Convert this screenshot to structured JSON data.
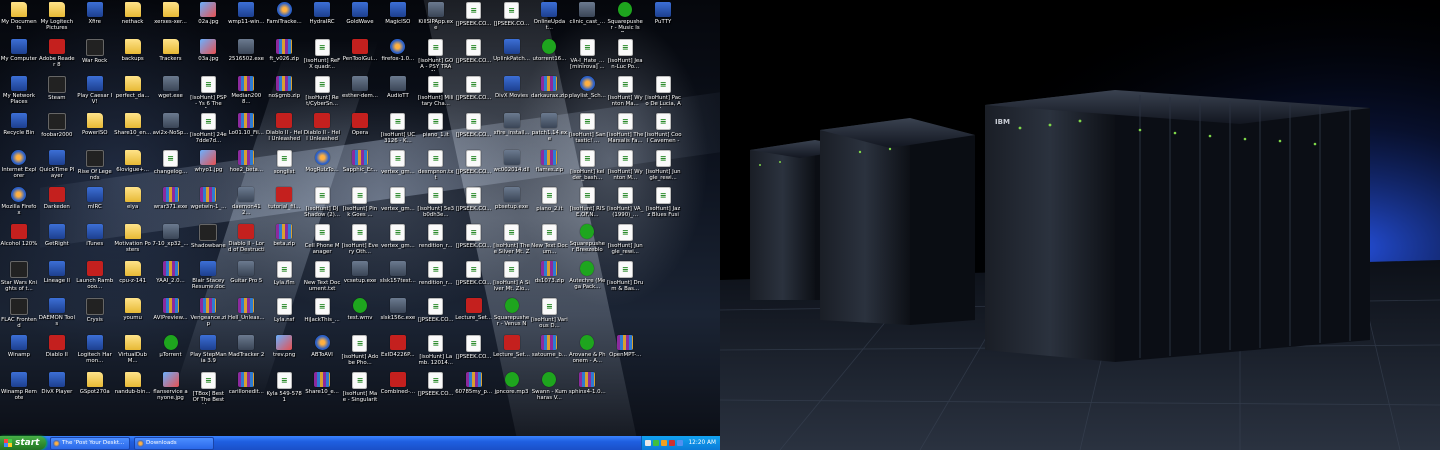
{
  "colors": {
    "taskbar": "#245edc",
    "start": "#2e8b2e",
    "tray": "#0f8fe8",
    "wallpaper_glow": "#2a5cff"
  },
  "desktop_icons": [
    {
      "label": "My Documents",
      "icon": "folder"
    },
    {
      "label": "My Logitech Pictures",
      "icon": "folder"
    },
    {
      "label": "Xfire",
      "icon": "app"
    },
    {
      "label": "nethack",
      "icon": "folder"
    },
    {
      "label": "xerxes-xer...",
      "icon": "folder"
    },
    {
      "label": "02a.jpg",
      "icon": "image"
    },
    {
      "label": "wmp11-win...",
      "icon": "app"
    },
    {
      "label": "FamiTracke...",
      "icon": "web"
    },
    {
      "label": "HydraIRC",
      "icon": "app"
    },
    {
      "label": "GoldWave",
      "icon": "app"
    },
    {
      "label": "MagicISO",
      "icon": "app"
    },
    {
      "label": "KillSIPApp.exe",
      "icon": "exe"
    },
    {
      "label": "[JPSEEK.CO...",
      "icon": "doc"
    },
    {
      "label": "[JPSEEK.CO...",
      "icon": "doc"
    },
    {
      "label": "OnlineUpdat...",
      "icon": "app"
    },
    {
      "label": "clinic_cast_...",
      "icon": "exe"
    },
    {
      "label": "Squarepusher - Music Is R...",
      "icon": "media"
    },
    {
      "label": "PuTTY",
      "icon": "app"
    },
    {
      "label": "",
      "icon": "none"
    },
    {
      "label": "My Computer",
      "icon": "app"
    },
    {
      "label": "Adobe Reader 8",
      "icon": "red"
    },
    {
      "label": "War Rock",
      "icon": "dark"
    },
    {
      "label": "backups",
      "icon": "folder"
    },
    {
      "label": "Trackers",
      "icon": "folder"
    },
    {
      "label": "03a.jpg",
      "icon": "image"
    },
    {
      "label": "2516502.exe",
      "icon": "exe"
    },
    {
      "label": "ft_v026.zip",
      "icon": "archive"
    },
    {
      "label": "[isoHunt] ReFX quadr...",
      "icon": "doc"
    },
    {
      "label": "PenToolGui...",
      "icon": "red"
    },
    {
      "label": "firefox-1.0...",
      "icon": "web"
    },
    {
      "label": "[isoHunt] GOA - PSY TRAN...",
      "icon": "doc"
    },
    {
      "label": "[JPSEEK.CO...",
      "icon": "doc"
    },
    {
      "label": "UplinkPatch...",
      "icon": "app"
    },
    {
      "label": "utorrent16...",
      "icon": "media"
    },
    {
      "label": "VA-I_Hate_... [minirova] ...",
      "icon": "doc"
    },
    {
      "label": "[isoHunt] Jean-Luc Po...",
      "icon": "doc"
    },
    {
      "label": "",
      "icon": "none"
    },
    {
      "label": "",
      "icon": "none"
    },
    {
      "label": "My Network Places",
      "icon": "app"
    },
    {
      "label": "Steam",
      "icon": "dark"
    },
    {
      "label": "Play Caesar IV!",
      "icon": "app"
    },
    {
      "label": "perfect_da...",
      "icon": "folder"
    },
    {
      "label": "wget.exe",
      "icon": "exe"
    },
    {
      "label": "[isoHunt] PSP - Ys 6 The A...",
      "icon": "doc"
    },
    {
      "label": "Median2008...",
      "icon": "archive"
    },
    {
      "label": "no$gmb.zip",
      "icon": "archive"
    },
    {
      "label": "[isoHunt] Ret/CyberSn...",
      "icon": "doc"
    },
    {
      "label": "esther-dem...",
      "icon": "exe"
    },
    {
      "label": "AudioTT",
      "icon": "exe"
    },
    {
      "label": "[isoHunt] Military Cha...",
      "icon": "doc"
    },
    {
      "label": "[JPSEEK.CO...",
      "icon": "doc"
    },
    {
      "label": "DivX Movies",
      "icon": "app"
    },
    {
      "label": "darkaurax.zip",
      "icon": "archive"
    },
    {
      "label": "playlist_Sch...",
      "icon": "web"
    },
    {
      "label": "[isoHunt] Wynton Ma...",
      "icon": "doc"
    },
    {
      "label": "[isoHunt] Paco De Lucia, Al...",
      "icon": "doc"
    },
    {
      "label": "",
      "icon": "none"
    },
    {
      "label": "Recycle Bin",
      "icon": "app"
    },
    {
      "label": "foobar2000",
      "icon": "dark"
    },
    {
      "label": "PowerISO",
      "icon": "folder"
    },
    {
      "label": "Share10_en...",
      "icon": "folder"
    },
    {
      "label": "avi2x-NoSp...",
      "icon": "exe"
    },
    {
      "label": "[isoHunt] 24e7dde7d...",
      "icon": "doc"
    },
    {
      "label": "Lo01.10_Fil...",
      "icon": "archive"
    },
    {
      "label": "Diablo II - Hell Unleashed",
      "icon": "red"
    },
    {
      "label": "Diablo II - Hell Unleashed ...",
      "icon": "red"
    },
    {
      "label": "Opera",
      "icon": "red"
    },
    {
      "label": "[isoHunt] UC3126 - K...",
      "icon": "doc"
    },
    {
      "label": "piano_1.it",
      "icon": "doc"
    },
    {
      "label": "[JPSEEK.CO...",
      "icon": "doc"
    },
    {
      "label": "xfire_install...",
      "icon": "exe"
    },
    {
      "label": "patch1.14.exe",
      "icon": "exe"
    },
    {
      "label": "[isoHunt] Santastic! ...",
      "icon": "doc"
    },
    {
      "label": "[isoHunt] The Marsalis Fa...",
      "icon": "doc"
    },
    {
      "label": "[isoHunt] Cool Cavemen - ...",
      "icon": "doc"
    },
    {
      "label": "",
      "icon": "none"
    },
    {
      "label": "Internet Explorer",
      "icon": "web"
    },
    {
      "label": "QuickTime Player",
      "icon": "app"
    },
    {
      "label": "Rise Of Legends",
      "icon": "dark"
    },
    {
      "label": "6lovigue+...",
      "icon": "folder"
    },
    {
      "label": "changelog...",
      "icon": "doc"
    },
    {
      "label": "whyo1.jpg",
      "icon": "image"
    },
    {
      "label": "hoe2_beta...",
      "icon": "archive"
    },
    {
      "label": "songlist",
      "icon": "doc"
    },
    {
      "label": "MogRulzTo...",
      "icon": "web"
    },
    {
      "label": "Sapphic_Er...",
      "icon": "archive"
    },
    {
      "label": "vertex_gm...",
      "icon": "doc"
    },
    {
      "label": "desmpnon.txt",
      "icon": "doc"
    },
    {
      "label": "[JPSEEK.CO...",
      "icon": "doc"
    },
    {
      "label": "wc002014.dll",
      "icon": "exe"
    },
    {
      "label": "flames.zip",
      "icon": "archive"
    },
    {
      "label": "[isoHunt] kelder_bash...",
      "icon": "doc"
    },
    {
      "label": "[isoHunt] Wynton M...",
      "icon": "doc"
    },
    {
      "label": "[isoHunt] Jungle_rewi...",
      "icon": "doc"
    },
    {
      "label": "",
      "icon": "none"
    },
    {
      "label": "Mozilla Firefox",
      "icon": "web"
    },
    {
      "label": "Darkeden",
      "icon": "red"
    },
    {
      "label": "mIRC",
      "icon": "app"
    },
    {
      "label": "eiya",
      "icon": "folder"
    },
    {
      "label": "wrar371.exe",
      "icon": "archive"
    },
    {
      "label": "wgetwin-1_...",
      "icon": "archive"
    },
    {
      "label": "daemon412...",
      "icon": "exe"
    },
    {
      "label": "tutorial_fil...",
      "icon": "red"
    },
    {
      "label": "[isoHunt] DJ Shadow (2)...",
      "icon": "doc"
    },
    {
      "label": "[isoHunt] Pink Goes ...",
      "icon": "doc"
    },
    {
      "label": "vertex_gm...",
      "icon": "doc"
    },
    {
      "label": "[isoHunt] 5e3b0dh3e...",
      "icon": "doc"
    },
    {
      "label": "[JPSEEK.CO...",
      "icon": "doc"
    },
    {
      "label": "pbsetup.exe",
      "icon": "exe"
    },
    {
      "label": "piano_2.it",
      "icon": "doc"
    },
    {
      "label": "[isoHunt] RISE.OF.N...",
      "icon": "doc"
    },
    {
      "label": "[isoHunt] VA_(1990)_...",
      "icon": "doc"
    },
    {
      "label": "[isoHunt] Jazz Blues Fusio...",
      "icon": "doc"
    },
    {
      "label": "",
      "icon": "none"
    },
    {
      "label": "Alcohol 120%",
      "icon": "red"
    },
    {
      "label": "GetRight",
      "icon": "app"
    },
    {
      "label": "iTunes",
      "icon": "app"
    },
    {
      "label": "Motivation Posters",
      "icon": "folder"
    },
    {
      "label": "7-10_xp32_...",
      "icon": "exe"
    },
    {
      "label": "Shadowbane",
      "icon": "dark"
    },
    {
      "label": "Diablo II - Lord of Destruction",
      "icon": "red"
    },
    {
      "label": "beta.zip",
      "icon": "archive"
    },
    {
      "label": "Cell Phone Manager",
      "icon": "doc"
    },
    {
      "label": "[isoHunt] Every Oth...",
      "icon": "doc"
    },
    {
      "label": "vertex_gm...",
      "icon": "doc"
    },
    {
      "label": "rendition_r...",
      "icon": "doc"
    },
    {
      "label": "[JPSEEK.CO...",
      "icon": "doc"
    },
    {
      "label": "[isoHunt] Thee Silver Mt. Zi...",
      "icon": "doc"
    },
    {
      "label": "New Text Docum...",
      "icon": "doc"
    },
    {
      "label": "Squarepusher Breezeblo c...",
      "icon": "media"
    },
    {
      "label": "[isoHunt] Jungle_rewi...",
      "icon": "doc"
    },
    {
      "label": "",
      "icon": "none"
    },
    {
      "label": "",
      "icon": "none"
    },
    {
      "label": "Star Wars Knights of t...",
      "icon": "dark"
    },
    {
      "label": "Lineage II",
      "icon": "app"
    },
    {
      "label": "Launch Rambooo...",
      "icon": "red"
    },
    {
      "label": "cpu-z-141",
      "icon": "folder"
    },
    {
      "label": "YAAI_2.0...",
      "icon": "archive"
    },
    {
      "label": "Blair Stacey Resume.doc",
      "icon": "app"
    },
    {
      "label": "Guitar Pro 5",
      "icon": "exe"
    },
    {
      "label": "Lyla.flm",
      "icon": "doc"
    },
    {
      "label": "New Text Document.txt",
      "icon": "doc"
    },
    {
      "label": "vcsetup.exe",
      "icon": "exe"
    },
    {
      "label": "slsk157test...",
      "icon": "exe"
    },
    {
      "label": "rendition_r...",
      "icon": "doc"
    },
    {
      "label": "[JPSEEK.CO...",
      "icon": "doc"
    },
    {
      "label": "[isoHunt] A Silver Mt. Zio...",
      "icon": "doc"
    },
    {
      "label": "ds1073.zip",
      "icon": "archive"
    },
    {
      "label": "Autechre (Mega Pack...",
      "icon": "media"
    },
    {
      "label": "[isoHunt] Drum & Bas...",
      "icon": "doc"
    },
    {
      "label": "",
      "icon": "none"
    },
    {
      "label": "",
      "icon": "none"
    },
    {
      "label": "FLAC Frontend",
      "icon": "dark"
    },
    {
      "label": "DAEMON Tools",
      "icon": "app"
    },
    {
      "label": "Crysis",
      "icon": "dark"
    },
    {
      "label": "youmu",
      "icon": "folder"
    },
    {
      "label": "AVIPreview...",
      "icon": "archive"
    },
    {
      "label": "Vengeance.zip",
      "icon": "archive"
    },
    {
      "label": "Hell_Unleas...",
      "icon": "archive"
    },
    {
      "label": "Lyla.nsf",
      "icon": "doc"
    },
    {
      "label": "HiJackThis_...",
      "icon": "doc"
    },
    {
      "label": "test.wmv",
      "icon": "media"
    },
    {
      "label": "slsk156c.exe",
      "icon": "exe"
    },
    {
      "label": "[JPSEEK.CO...",
      "icon": "doc"
    },
    {
      "label": "Lecture_Set...",
      "icon": "red"
    },
    {
      "label": "Squarepusher - Venus No...",
      "icon": "media"
    },
    {
      "label": "[isoHunt] Various D...",
      "icon": "doc"
    },
    {
      "label": "",
      "icon": "none"
    },
    {
      "label": "",
      "icon": "none"
    },
    {
      "label": "",
      "icon": "none"
    },
    {
      "label": "",
      "icon": "none"
    },
    {
      "label": "Winamp",
      "icon": "app"
    },
    {
      "label": "Diablo II",
      "icon": "red"
    },
    {
      "label": "Logitech Harmon...",
      "icon": "app"
    },
    {
      "label": "VirtualDubM...",
      "icon": "folder"
    },
    {
      "label": "µTorrent",
      "icon": "media"
    },
    {
      "label": "Play StepMania 3.9",
      "icon": "app"
    },
    {
      "label": "MadTracker 2",
      "icon": "exe"
    },
    {
      "label": "trev.png",
      "icon": "image"
    },
    {
      "label": "ABToAVI",
      "icon": "web"
    },
    {
      "label": "[isoHunt] Adobe Pho...",
      "icon": "doc"
    },
    {
      "label": "ExID4226P...",
      "icon": "red"
    },
    {
      "label": "[isoHunt] Lamb. 12014...",
      "icon": "doc"
    },
    {
      "label": "[JPSEEK.CO...",
      "icon": "doc"
    },
    {
      "label": "Lecture_Set...",
      "icon": "red"
    },
    {
      "label": "satourne_b...",
      "icon": "archive"
    },
    {
      "label": "Arovane & Phonem - A...",
      "icon": "media"
    },
    {
      "label": "OpenMPT-...",
      "icon": "archive"
    },
    {
      "label": "",
      "icon": "none"
    },
    {
      "label": "",
      "icon": "none"
    },
    {
      "label": "Winamp Remote",
      "icon": "app"
    },
    {
      "label": "DivX Player",
      "icon": "app"
    },
    {
      "label": "GSpot270a",
      "icon": "folder"
    },
    {
      "label": "nandub-bin...",
      "icon": "folder"
    },
    {
      "label": "flanservice anyone.jpg",
      "icon": "image"
    },
    {
      "label": "[TBox] Best Of The Best Ha...",
      "icon": "doc"
    },
    {
      "label": "carillonedit...",
      "icon": "archive"
    },
    {
      "label": "Kyla 549-5781",
      "icon": "doc"
    },
    {
      "label": "Share10_e...",
      "icon": "archive"
    },
    {
      "label": "[isoHunt] Mae - Singularity...",
      "icon": "doc"
    },
    {
      "label": "Combined-...",
      "icon": "red"
    },
    {
      "label": "[JPSEEK.CO...",
      "icon": "doc"
    },
    {
      "label": "60785my_p...",
      "icon": "archive"
    },
    {
      "label": "jpncore.mp3",
      "icon": "media"
    },
    {
      "label": "Swann - Kumharas V...",
      "icon": "media"
    },
    {
      "label": "sphinx4-1.0...",
      "icon": "archive"
    },
    {
      "label": "",
      "icon": "none"
    },
    {
      "label": "",
      "icon": "none"
    },
    {
      "label": "",
      "icon": "none"
    }
  ],
  "taskbar": {
    "start_label": "start",
    "windows": [
      {
        "label": "The 'Post Your Deskt...",
        "active": false
      },
      {
        "label": "Downloads",
        "active": false
      }
    ],
    "clock": "12:20 AM"
  },
  "wallpaper_right": {
    "brand_text": "IBM"
  }
}
